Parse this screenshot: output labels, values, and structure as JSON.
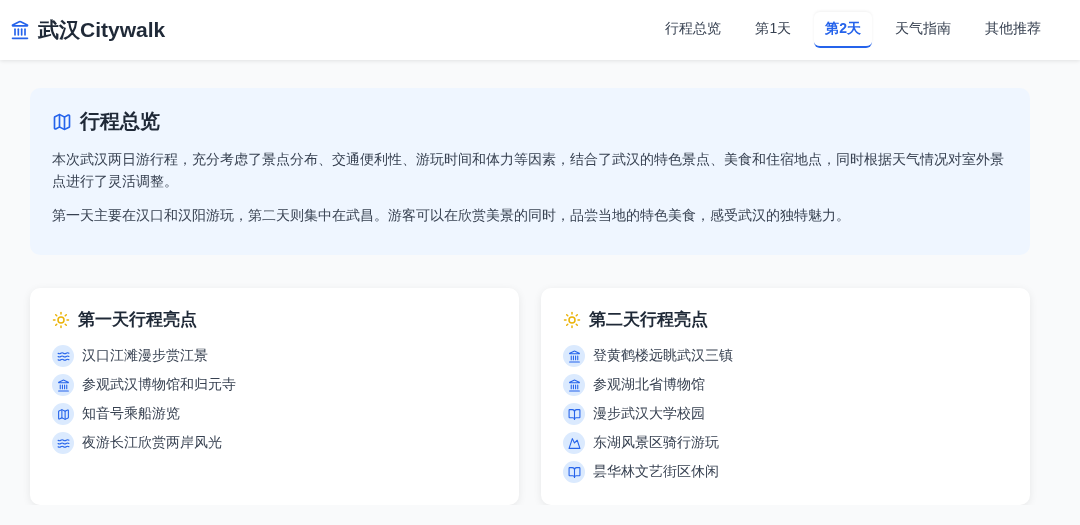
{
  "header": {
    "logo": "武汉Citywalk",
    "nav": [
      {
        "label": "行程总览",
        "selected": false
      },
      {
        "label": "第1天",
        "selected": false
      },
      {
        "label": "第2天",
        "selected": true
      },
      {
        "label": "天气指南",
        "selected": false
      },
      {
        "label": "其他推荐",
        "selected": false
      }
    ]
  },
  "overview": {
    "title": "行程总览",
    "paragraphs": [
      "本次武汉两日游行程，充分考虑了景点分布、交通便利性、游玩时间和体力等因素，结合了武汉的特色景点、美食和住宿地点，同时根据天气情况对室外景点进行了灵活调整。",
      "第一天主要在汉口和汉阳游玩，第二天则集中在武昌。游客可以在欣赏美景的同时，品尝当地的特色美食，感受武汉的独特魅力。"
    ]
  },
  "highlights": [
    {
      "title": "第一天行程亮点",
      "items": [
        {
          "kind": "waves",
          "text": "汉口江滩漫步赏江景"
        },
        {
          "kind": "landmark",
          "text": "参观武汉博物馆和归元寺"
        },
        {
          "kind": "map",
          "text": "知音号乘船游览"
        },
        {
          "kind": "waves",
          "text": "夜游长江欣赏两岸风光"
        }
      ]
    },
    {
      "title": "第二天行程亮点",
      "items": [
        {
          "kind": "landmark",
          "text": "登黄鹤楼远眺武汉三镇"
        },
        {
          "kind": "landmark",
          "text": "参观湖北省博物馆"
        },
        {
          "kind": "book",
          "text": "漫步武汉大学校园"
        },
        {
          "kind": "mountain",
          "text": "东湖风景区骑行游玩"
        },
        {
          "kind": "book",
          "text": "昙华林文艺街区休闲"
        }
      ]
    }
  ]
}
